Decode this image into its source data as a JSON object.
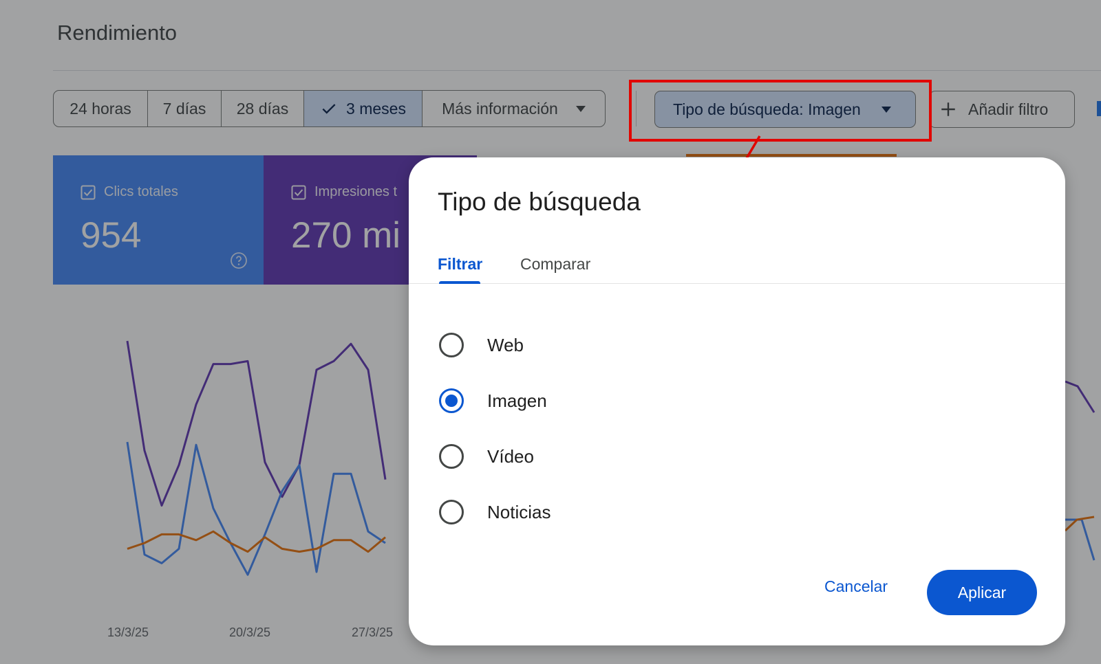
{
  "page": {
    "title": "Rendimiento"
  },
  "date_range": {
    "options": [
      {
        "label": "24 horas",
        "selected": false
      },
      {
        "label": "7 días",
        "selected": false
      },
      {
        "label": "28 días",
        "selected": false
      },
      {
        "label": "3 meses",
        "selected": true
      }
    ],
    "more_label": "Más información"
  },
  "filters": {
    "search_type_chip": "Tipo de búsqueda: Imagen",
    "add_filter_label": "Añadir filtro"
  },
  "metrics": [
    {
      "label": "Clics totales",
      "value": "954",
      "color": "#4285f4"
    },
    {
      "label": "Impresiones t",
      "value": "270 mi",
      "color": "#5e35b1"
    }
  ],
  "chart_data": {
    "type": "line",
    "x_tick_labels": [
      "13/3/25",
      "20/3/25",
      "27/3/25"
    ],
    "series": [
      {
        "color": "#5e35b1",
        "values": [
          90,
          52,
          33,
          47,
          68,
          82,
          82,
          83,
          48,
          36,
          47,
          80,
          83,
          89,
          80,
          42
        ]
      },
      {
        "color": "#4285f4",
        "values": [
          55,
          16,
          13,
          18,
          54,
          32,
          20,
          9,
          23,
          38,
          47,
          10,
          44,
          44,
          24,
          20
        ]
      },
      {
        "color": "#e8710a",
        "values": [
          18,
          20,
          23,
          23,
          21,
          24,
          20,
          17,
          22,
          18,
          17,
          18,
          21,
          21,
          17,
          22
        ]
      }
    ]
  },
  "dialog": {
    "title": "Tipo de búsqueda",
    "tabs": [
      {
        "label": "Filtrar",
        "active": true
      },
      {
        "label": "Comparar",
        "active": false
      }
    ],
    "options": [
      {
        "label": "Web",
        "checked": false
      },
      {
        "label": "Imagen",
        "checked": true
      },
      {
        "label": "Vídeo",
        "checked": false
      },
      {
        "label": "Noticias",
        "checked": false
      }
    ],
    "cancel_label": "Cancelar",
    "apply_label": "Aplicar"
  },
  "colors": {
    "accent": "#0b57d0",
    "annotation": "#e10600"
  }
}
